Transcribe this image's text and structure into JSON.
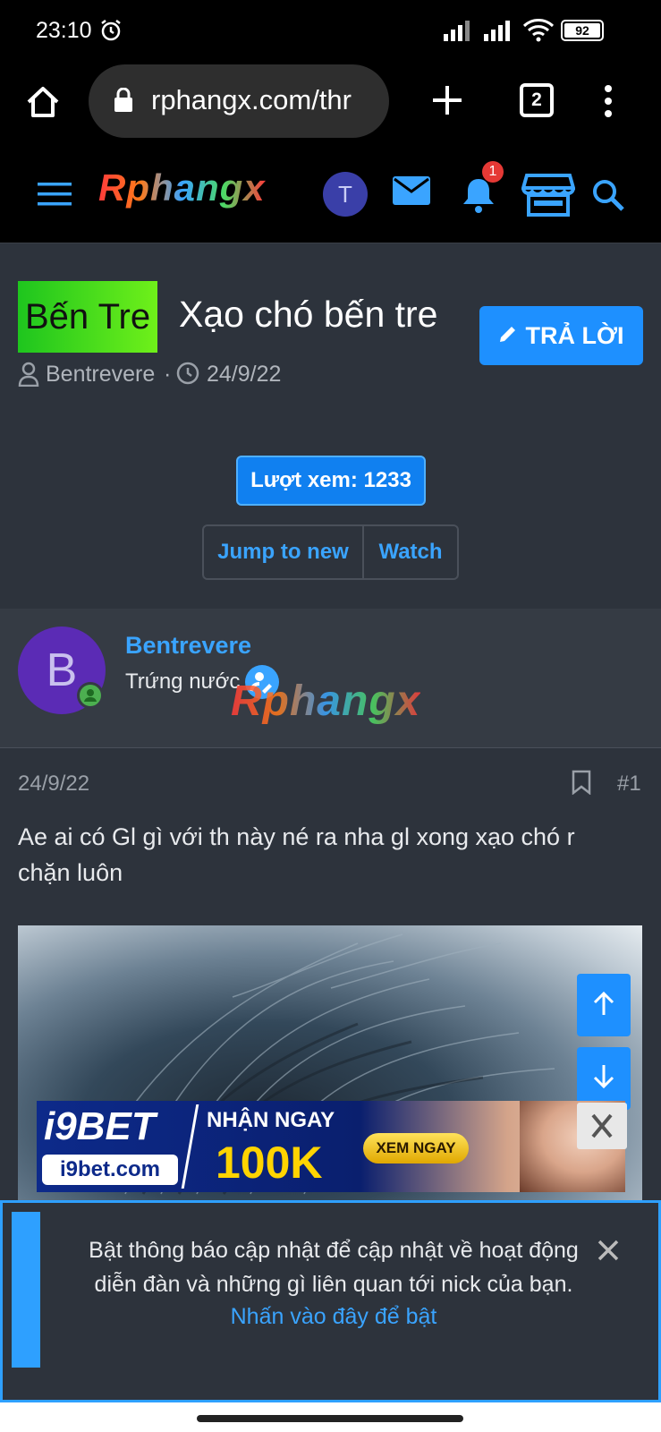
{
  "status_bar": {
    "time": "23:10",
    "battery": "92"
  },
  "browser": {
    "url": "rphangx.com/thr",
    "tab_count": "2"
  },
  "site": {
    "logo": "Rphangx",
    "avatar_letter": "T",
    "alerts_count": "1"
  },
  "thread": {
    "prefix": "Bến Tre",
    "title": "Xạo chó bến tre",
    "author": "Bentrevere",
    "date": "24/9/22",
    "reply_label": "TRẢ LỜI",
    "views": "Lượt xem: 1233",
    "jump_label": "Jump to new",
    "watch_label": "Watch"
  },
  "post": {
    "avatar_letter": "B",
    "username": "Bentrevere",
    "user_title": "Trứng nước",
    "watermark": "Rphangx",
    "date": "24/9/22",
    "number": "#1",
    "text": "Ae ai có Gl gì với th này né ra nha gl xong xạo chó r chặn luôn"
  },
  "ad": {
    "brand": "i9BET",
    "domain": "i9bet.com",
    "headline": "NHẬN NGAY",
    "amount": "100K",
    "cta": "XEM NGAY"
  },
  "notification": {
    "message": "Bật thông báo cập nhật để cập nhật về hoạt động diễn đàn và những gì liên quan tới nick của bạn.",
    "link": "Nhấn vào đây để bật"
  }
}
